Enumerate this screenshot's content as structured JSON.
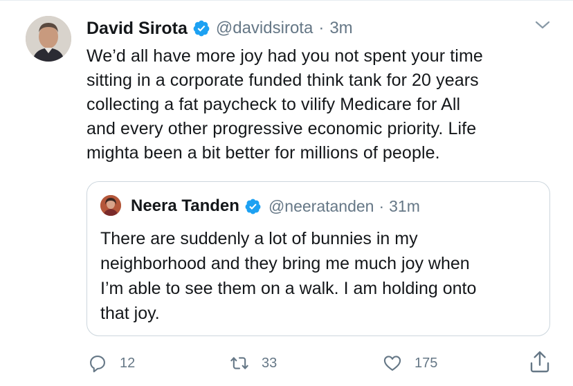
{
  "tweet": {
    "author_name": "David Sirota",
    "handle": "@davidsirota",
    "separator": "·",
    "time": "3m",
    "text_lines": [
      "We’d all have more joy had you not spent your time",
      "sitting in a corporate funded think tank for 20 years",
      "collecting a fat paycheck to vilify Medicare for All",
      "and every other progressive economic priority. Life",
      "mighta been a bit better for millions of people."
    ]
  },
  "quoted_tweet": {
    "author_name": "Neera Tanden",
    "handle": "@neeratanden",
    "separator": "·",
    "time": "31m",
    "text_lines": [
      "There are suddenly a lot of bunnies in my",
      "neighborhood and they bring me much joy when",
      "I’m able to see them on a walk. I am holding onto",
      "that joy."
    ]
  },
  "actions": {
    "replies": "12",
    "retweets": "33",
    "likes": "175"
  },
  "colors": {
    "verified": "#1da1f2",
    "secondary_text": "#657786",
    "border": "#ccd6dd"
  },
  "icons": {
    "reply": "reply-icon",
    "retweet": "retweet-icon",
    "like": "heart-icon",
    "share": "share-icon",
    "menu": "chevron-down-icon",
    "verified": "verified-badge-icon"
  }
}
